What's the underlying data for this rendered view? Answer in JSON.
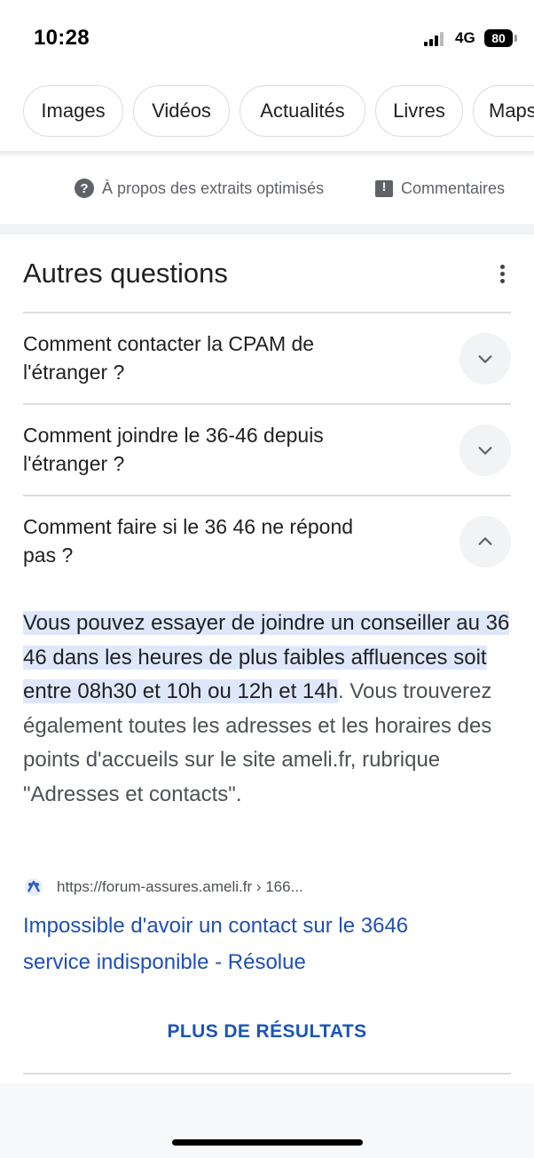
{
  "status_bar": {
    "time": "10:28",
    "network": "4G",
    "battery": "80"
  },
  "chips": [
    {
      "label": "Images"
    },
    {
      "label": "Vidéos"
    },
    {
      "label": "Actualités"
    },
    {
      "label": "Livres"
    },
    {
      "label": "Maps"
    }
  ],
  "about_row": {
    "about_label": "À propos des extraits optimisés",
    "about_icon": "question-circle-icon",
    "feedback_label": "Commentaires",
    "feedback_icon": "feedback-icon"
  },
  "paa": {
    "title": "Autres questions",
    "questions": [
      {
        "line1": "Comment contacter la CPAM de",
        "line2": "l'étranger ?",
        "expanded": false
      },
      {
        "line1": "Comment joindre le 36-46 depuis",
        "line2": "l'étranger ?",
        "expanded": false
      },
      {
        "line1": "Comment faire si le 36 46 ne répond",
        "line2": "pas ?",
        "expanded": true
      }
    ],
    "answer": {
      "highlighted": "Vous pouvez essayer de joindre un conseiller au 36 46 dans les heures de plus faibles affluences soit entre 08h30 et 10h ou 12h et 14h",
      "rest": ". Vous trouverez également toutes les adresses et les horaires des points d'accueils sur le site ameli.fr, rubrique \"Adresses et contacts\"."
    },
    "source": {
      "url": "https://forum-assures.ameli.fr › 166...",
      "favicon": "ameli-favicon-icon",
      "title_line1": "Impossible d'avoir un contact sur le 3646",
      "title_line2": "service indisponible - Résolue"
    },
    "more_results": "PLUS DE RÉSULTATS"
  },
  "colors": {
    "link": "#1f4fb5",
    "highlight": "#dfe8fb",
    "text": "#202124",
    "secondary": "#4d5156"
  }
}
